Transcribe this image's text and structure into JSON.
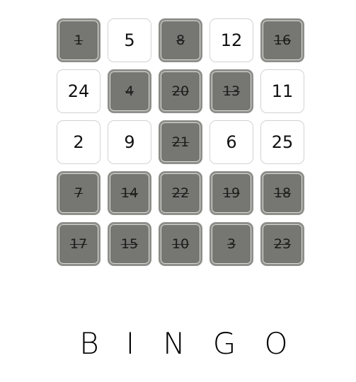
{
  "board": {
    "cells": [
      {
        "number": "1",
        "marked": true
      },
      {
        "number": "5",
        "marked": false
      },
      {
        "number": "8",
        "marked": true
      },
      {
        "number": "12",
        "marked": false
      },
      {
        "number": "16",
        "marked": true
      },
      {
        "number": "24",
        "marked": false
      },
      {
        "number": "4",
        "marked": true
      },
      {
        "number": "20",
        "marked": true
      },
      {
        "number": "13",
        "marked": true
      },
      {
        "number": "11",
        "marked": false
      },
      {
        "number": "2",
        "marked": false
      },
      {
        "number": "9",
        "marked": false
      },
      {
        "number": "21",
        "marked": true
      },
      {
        "number": "6",
        "marked": false
      },
      {
        "number": "25",
        "marked": false
      },
      {
        "number": "7",
        "marked": true
      },
      {
        "number": "14",
        "marked": true
      },
      {
        "number": "22",
        "marked": true
      },
      {
        "number": "19",
        "marked": true
      },
      {
        "number": "18",
        "marked": true
      },
      {
        "number": "17",
        "marked": true
      },
      {
        "number": "15",
        "marked": true
      },
      {
        "number": "10",
        "marked": true
      },
      {
        "number": "3",
        "marked": true
      },
      {
        "number": "23",
        "marked": true
      }
    ]
  },
  "title": {
    "letters": [
      "B",
      "I",
      "N",
      "G",
      "O"
    ]
  },
  "colors": {
    "marked_fill": "#767672",
    "unmarked_fill": "#ffffff"
  }
}
